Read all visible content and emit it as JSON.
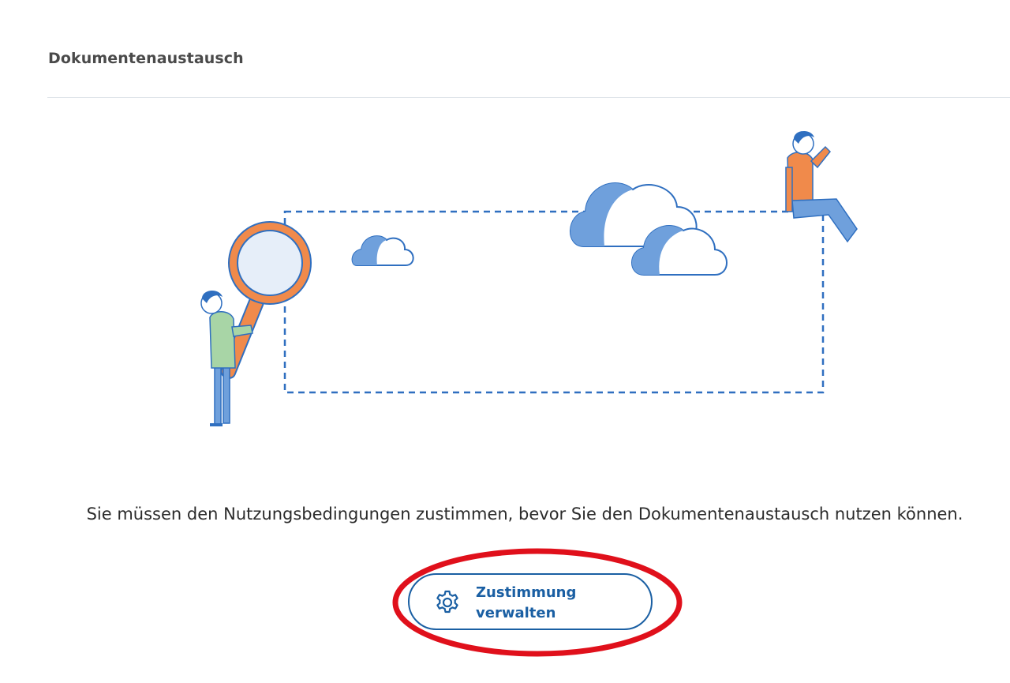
{
  "header": {
    "title": "Dokumentenaustausch"
  },
  "illustration": {
    "icon": "document-exchange-search-illustration"
  },
  "message": {
    "text": "Sie müssen den Nutzungsbedingungen zustimmen, bevor Sie den Dokumentenaustausch nutzen können."
  },
  "consent_button": {
    "label": "Zustimmung verwalten",
    "icon": "gear-icon"
  },
  "colors": {
    "accent": "#1a5fa3",
    "highlight": "#e0101b",
    "cloud": "#6fa0dc",
    "person_orange": "#f08a4b"
  }
}
